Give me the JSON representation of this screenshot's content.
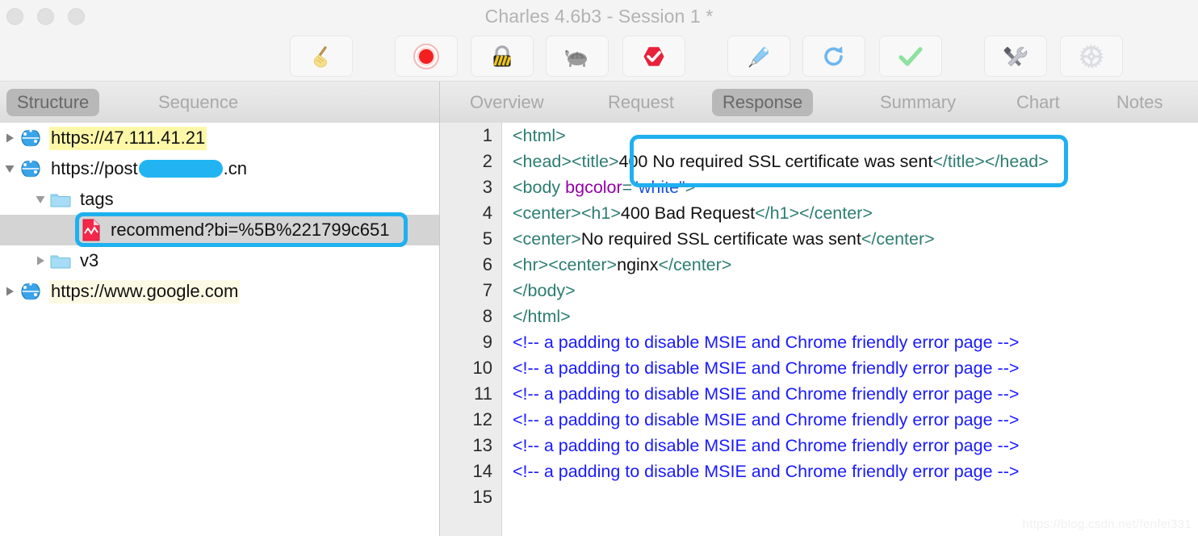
{
  "window": {
    "title": "Charles 4.6b3 - Session 1 *",
    "traffic_lights": [
      "close",
      "minimize",
      "zoom"
    ]
  },
  "toolbar": {
    "buttons": [
      {
        "name": "clear-session-button",
        "icon": "broom-icon",
        "label": "Clear"
      },
      {
        "name": "record-button",
        "icon": "record-icon",
        "label": "Start/Stop Recording"
      },
      {
        "name": "ssl-proxying-button",
        "icon": "lock-icon",
        "label": "SSL Proxying"
      },
      {
        "name": "throttling-button",
        "icon": "turtle-icon",
        "label": "Throttle Settings"
      },
      {
        "name": "breakpoints-button",
        "icon": "stop-check-icon",
        "label": "Breakpoints"
      },
      {
        "name": "compose-button",
        "icon": "pen-icon",
        "label": "Compose"
      },
      {
        "name": "repeat-button",
        "icon": "refresh-icon",
        "label": "Repeat"
      },
      {
        "name": "validate-button",
        "icon": "checkmark-icon",
        "label": "Validate"
      },
      {
        "name": "tools-button",
        "icon": "tools-icon",
        "label": "Tools"
      },
      {
        "name": "settings-button",
        "icon": "gear-icon",
        "label": "Settings"
      }
    ]
  },
  "left_panel": {
    "tabs": [
      {
        "label": "Structure",
        "active": true
      },
      {
        "label": "Sequence",
        "active": false
      }
    ],
    "tree": [
      {
        "label": "https://47.111.41.21",
        "icon": "globe-icon",
        "arrow": "collapsed",
        "indent": 0,
        "highlight": "yellow",
        "selected": false,
        "redacted": false
      },
      {
        "label_before": "https://post",
        "label_after": ".cn",
        "icon": "globe-icon",
        "arrow": "expanded",
        "indent": 0,
        "highlight": "none",
        "selected": false,
        "redacted": true
      },
      {
        "label": "tags",
        "icon": "folder-icon",
        "arrow": "expanded",
        "indent": 1,
        "highlight": "none",
        "selected": false,
        "redacted": false
      },
      {
        "label": "recommend?bi=%5B%221799c651",
        "icon": "document-red-icon",
        "arrow": "none",
        "indent": 2,
        "highlight": "none",
        "selected": true,
        "redacted": false
      },
      {
        "label": "v3",
        "icon": "folder-icon",
        "arrow": "collapsed",
        "indent": 1,
        "highlight": "none",
        "selected": false,
        "redacted": false
      },
      {
        "label": "https://www.google.com",
        "icon": "globe-icon",
        "arrow": "collapsed",
        "indent": 0,
        "highlight": "soft-yellow",
        "selected": false,
        "redacted": false
      }
    ]
  },
  "right_panel": {
    "tabs": [
      {
        "label": "Overview",
        "active": false
      },
      {
        "label": "Request",
        "active": false
      },
      {
        "label": "Response",
        "active": true
      },
      {
        "label": "Summary",
        "active": false
      },
      {
        "label": "Chart",
        "active": false
      },
      {
        "label": "Notes",
        "active": false
      }
    ],
    "line_numbers": [
      "1",
      "2",
      "3",
      "4",
      "5",
      "6",
      "7",
      "8",
      "9",
      "10",
      "11",
      "12",
      "13",
      "14",
      "15"
    ],
    "code_lines": [
      [
        {
          "t": "tag",
          "v": "<html>"
        }
      ],
      [
        {
          "t": "tag",
          "v": "<head><title>"
        },
        {
          "t": "txt",
          "v": "400 No required SSL certificate was sent"
        },
        {
          "t": "tag",
          "v": "</title></head>"
        }
      ],
      [
        {
          "t": "tag",
          "v": "<body "
        },
        {
          "t": "attr",
          "v": "bgcolor"
        },
        {
          "t": "tag",
          "v": "="
        },
        {
          "t": "val",
          "v": "\"white\""
        },
        {
          "t": "tag",
          "v": ">"
        }
      ],
      [
        {
          "t": "tag",
          "v": "<center><h1>"
        },
        {
          "t": "txt",
          "v": "400 Bad Request"
        },
        {
          "t": "tag",
          "v": "</h1></center>"
        }
      ],
      [
        {
          "t": "tag",
          "v": "<center>"
        },
        {
          "t": "txt",
          "v": "No required SSL certificate was sent"
        },
        {
          "t": "tag",
          "v": "</center>"
        }
      ],
      [
        {
          "t": "tag",
          "v": "<hr><center>"
        },
        {
          "t": "txt",
          "v": "nginx"
        },
        {
          "t": "tag",
          "v": "</center>"
        }
      ],
      [
        {
          "t": "tag",
          "v": "</body>"
        }
      ],
      [
        {
          "t": "tag",
          "v": "</html>"
        }
      ],
      [
        {
          "t": "cmt",
          "v": "<!-- a padding to disable MSIE and Chrome friendly error page -->"
        }
      ],
      [
        {
          "t": "cmt",
          "v": "<!-- a padding to disable MSIE and Chrome friendly error page -->"
        }
      ],
      [
        {
          "t": "cmt",
          "v": "<!-- a padding to disable MSIE and Chrome friendly error page -->"
        }
      ],
      [
        {
          "t": "cmt",
          "v": "<!-- a padding to disable MSIE and Chrome friendly error page -->"
        }
      ],
      [
        {
          "t": "cmt",
          "v": "<!-- a padding to disable MSIE and Chrome friendly error page -->"
        }
      ],
      [
        {
          "t": "cmt",
          "v": "<!-- a padding to disable MSIE and Chrome friendly error page -->"
        }
      ],
      []
    ]
  },
  "annotations": {
    "tree_callout": "recommend-request-highlight",
    "code_callout": "response-title-highlight",
    "callout_color": "#1fb0ef"
  },
  "watermark": {
    "text": "https://blog.csdn.net/fenfei331"
  }
}
